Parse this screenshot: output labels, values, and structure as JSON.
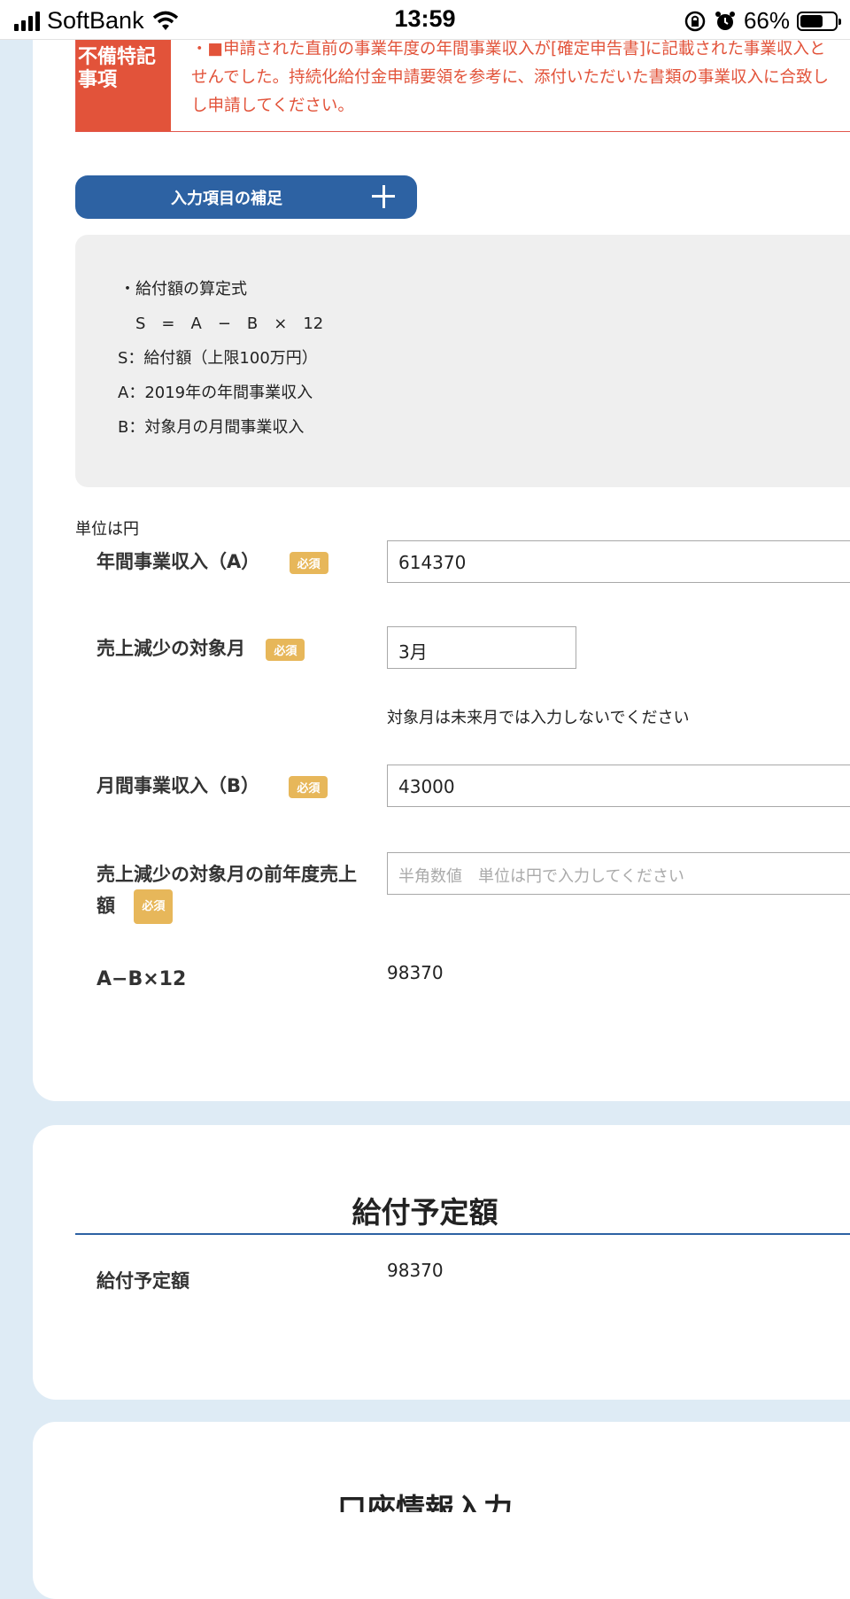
{
  "status_bar": {
    "carrier": "SoftBank",
    "time": "13:59",
    "battery_percent": "66%",
    "battery_level": 0.66
  },
  "notice": {
    "label": "不備特記事項",
    "lines": [
      "・■申請された直前の事業年度の年間事業収入が[確定申告書]に記載された事業収入と",
      "せんでした。持続化給付金申請要領を参考に、添付いただいた書類の事業収入に合致し",
      "し申請してください。"
    ]
  },
  "supplement_button": {
    "label": "入力項目の補足"
  },
  "formula": {
    "title": "・給付額の算定式",
    "expression": "S　=　A　−　B　×　12",
    "s": "S：給付額（上限100万円）",
    "a": "A：2019年の年間事業収入",
    "b": "B：対象月の月間事業収入"
  },
  "unit_note": "単位は円",
  "required_badge": "必須",
  "fields": {
    "annual_income": {
      "label": "年間事業収入（A）",
      "value": "614370"
    },
    "target_month": {
      "label": "売上減少の対象月",
      "value": "3月",
      "note": "対象月は未来月では入力しないでください"
    },
    "monthly_income": {
      "label": "月間事業収入（B）",
      "value": "43000"
    },
    "prev_year_sales": {
      "label_line1": "売上減少の対象月の前年度売上",
      "label_line2": "額",
      "placeholder": "半角数値　単位は円で入力してください"
    },
    "calc": {
      "label": "A−B×12",
      "value": "98370"
    }
  },
  "payment": {
    "title": "給付予定額",
    "label": "給付予定額",
    "value": "98370"
  },
  "account": {
    "title": "口座情報入力"
  }
}
